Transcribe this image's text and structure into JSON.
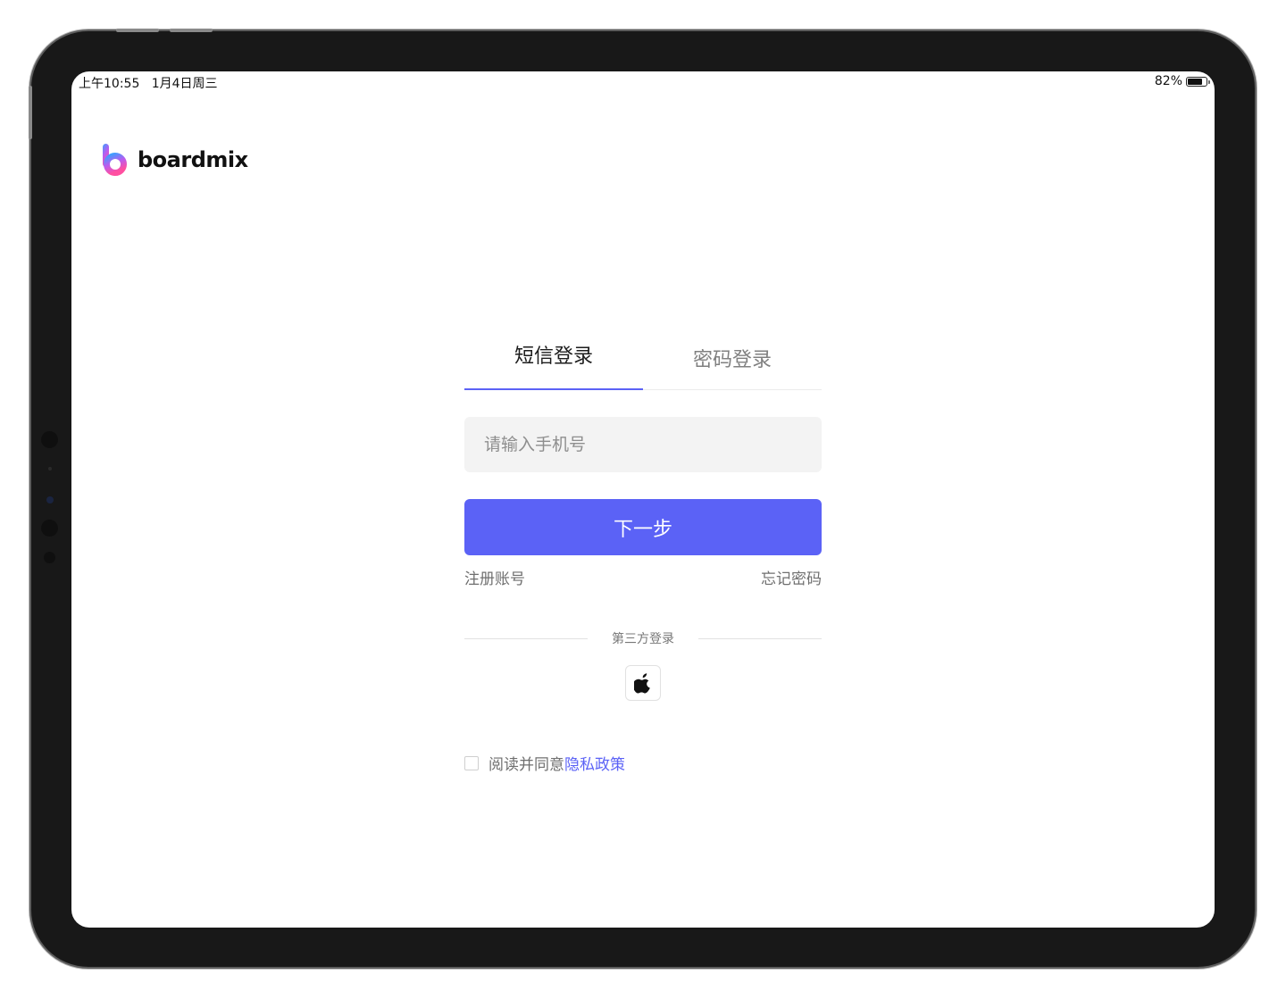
{
  "status_bar": {
    "time": "上午10:55   1月4日周三",
    "battery": "82%",
    "battery_level": 0.82
  },
  "brand": {
    "name": "boardmix",
    "colors": {
      "logo_top": "#3aa0ff",
      "logo_bottom": "#ff4fa0"
    }
  },
  "login": {
    "tabs": [
      {
        "label": "短信登录",
        "active": true
      },
      {
        "label": "密码登录",
        "active": false
      }
    ],
    "phone_input": {
      "placeholder": "请输入手机号",
      "value": ""
    },
    "next_button": "下一步",
    "register_link": "注册账号",
    "forgot_link": "忘记密码",
    "third_party_label": "第三方登录",
    "third_party_providers": [
      {
        "icon": "apple-icon"
      }
    ],
    "agreement": {
      "text": "阅读并同意",
      "policy_link": "隐私政策",
      "checked": false
    }
  },
  "colors": {
    "accent": "#5b62f6",
    "input_bg": "#f3f3f3",
    "muted_text": "#6f6f6f"
  }
}
